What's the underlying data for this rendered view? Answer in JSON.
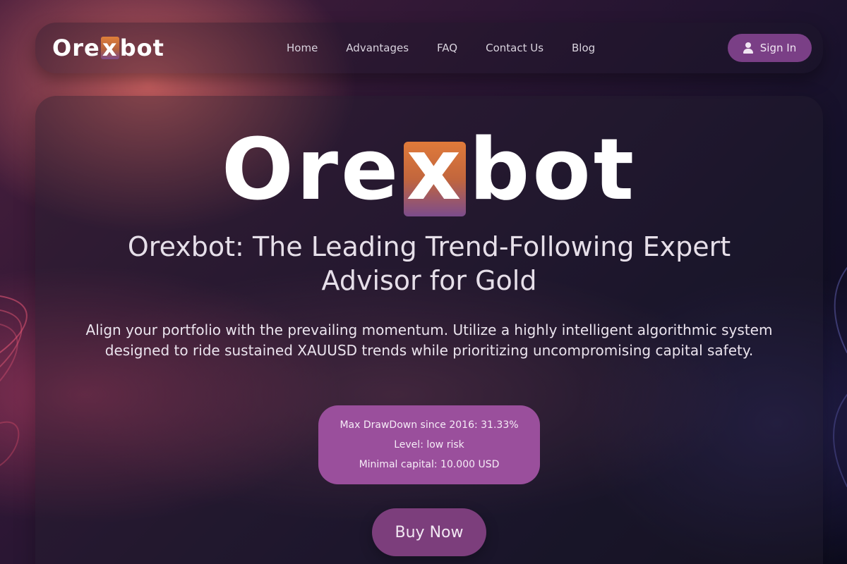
{
  "brand": {
    "name_prefix": "Ore",
    "name_highlight": "x",
    "name_suffix": "bot"
  },
  "nav": {
    "links": [
      "Home",
      "Advantages",
      "FAQ",
      "Contact Us",
      "Blog"
    ],
    "signin_label": "Sign In",
    "signin_icon": "user-icon"
  },
  "hero": {
    "headline": "Orexbot: The Leading Trend-Following Expert Advisor for Gold",
    "subtext": "Align your portfolio with the prevailing momentum. Utilize a highly intelligent algorithmic system designed to ride sustained XAUUSD trends while prioritizing uncompromising capital safety.",
    "stats": [
      "Max DrawDown since 2016: 31.33%",
      "Level: low risk",
      "Minimal capital: 10.000 USD"
    ],
    "cta_label": "Buy Now"
  },
  "colors": {
    "accent": "#9a4f9c",
    "button": "#7c3e7c",
    "logo_orange": "#e07a3a"
  }
}
